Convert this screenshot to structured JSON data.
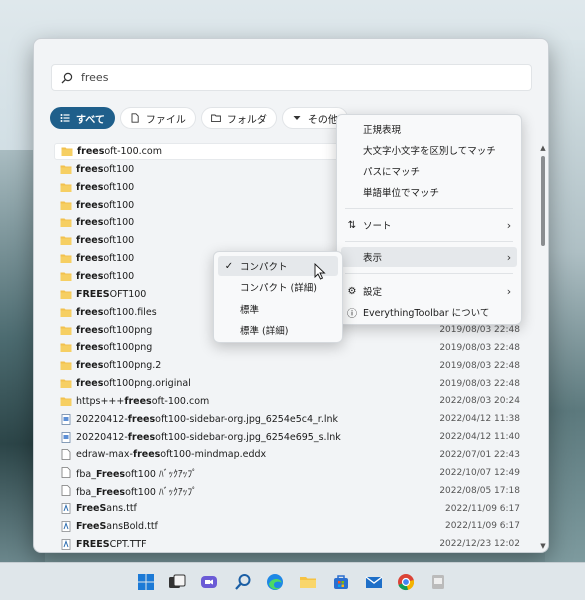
{
  "search": {
    "value": "frees"
  },
  "filters": [
    {
      "label": "すべて",
      "icon": "list-icon",
      "active": true
    },
    {
      "label": "ファイル",
      "icon": "file-icon",
      "active": false
    },
    {
      "label": "フォルダ",
      "icon": "folder-icon",
      "active": false
    },
    {
      "label": "その他",
      "icon": "caret-down-icon",
      "active": false
    }
  ],
  "results": [
    {
      "prefix": "",
      "hl": "frees",
      "rest": "oft-100.com",
      "date": "",
      "type": "folder"
    },
    {
      "prefix": "",
      "hl": "frees",
      "rest": "oft100",
      "date": "",
      "type": "folder"
    },
    {
      "prefix": "",
      "hl": "frees",
      "rest": "oft100",
      "date": "",
      "type": "folder"
    },
    {
      "prefix": "",
      "hl": "frees",
      "rest": "oft100",
      "date": "",
      "type": "folder"
    },
    {
      "prefix": "",
      "hl": "frees",
      "rest": "oft100",
      "date": "",
      "type": "folder"
    },
    {
      "prefix": "",
      "hl": "frees",
      "rest": "oft100",
      "date": "",
      "type": "folder"
    },
    {
      "prefix": "",
      "hl": "frees",
      "rest": "oft100",
      "date": "",
      "type": "folder"
    },
    {
      "prefix": "",
      "hl": "frees",
      "rest": "oft100",
      "date": "",
      "type": "folder"
    },
    {
      "prefix": "",
      "hl": "FREES",
      "rest": "OFT100",
      "date": "",
      "type": "folder"
    },
    {
      "prefix": "",
      "hl": "frees",
      "rest": "oft100.files",
      "date": "",
      "type": "folder"
    },
    {
      "prefix": "",
      "hl": "frees",
      "rest": "oft100png",
      "date": "2019/08/03 22:48",
      "type": "folder"
    },
    {
      "prefix": "",
      "hl": "frees",
      "rest": "oft100png",
      "date": "2019/08/03 22:48",
      "type": "folder"
    },
    {
      "prefix": "",
      "hl": "frees",
      "rest": "oft100png.2",
      "date": "2019/08/03 22:48",
      "type": "folder"
    },
    {
      "prefix": "",
      "hl": "frees",
      "rest": "oft100png.original",
      "date": "2019/08/03 22:48",
      "type": "folder"
    },
    {
      "prefix": "https+++",
      "hl": "frees",
      "rest": "oft-100.com",
      "date": "2022/08/03 20:24",
      "type": "folder"
    },
    {
      "prefix": "20220412-",
      "hl": "frees",
      "rest": "oft100-sidebar-org.jpg_6254e5c4_r.lnk",
      "date": "2022/04/12 11:38",
      "type": "link"
    },
    {
      "prefix": "20220412-",
      "hl": "frees",
      "rest": "oft100-sidebar-org.jpg_6254e695_s.lnk",
      "date": "2022/04/12 11:40",
      "type": "link"
    },
    {
      "prefix": "edraw-max-",
      "hl": "frees",
      "rest": "oft100-mindmap.eddx",
      "date": "2022/07/01 22:43",
      "type": "file"
    },
    {
      "prefix": "fba_",
      "hl": "Frees",
      "rest": "oft100 ﾊﾞｯｸｱｯﾌﾟ",
      "date": "2022/10/07 12:49",
      "type": "doc"
    },
    {
      "prefix": "fba_",
      "hl": "Frees",
      "rest": "oft100 ﾊﾞｯｸｱｯﾌﾟ",
      "date": "2022/08/05 17:18",
      "type": "doc"
    },
    {
      "prefix": "",
      "hl": "FreeS",
      "rest": "ans.ttf",
      "date": "2022/11/09 6:17",
      "type": "font"
    },
    {
      "prefix": "",
      "hl": "FreeS",
      "rest": "ansBold.ttf",
      "date": "2022/11/09 6:17",
      "type": "font"
    },
    {
      "prefix": "",
      "hl": "FREES",
      "rest": "CPT.TTF",
      "date": "2022/12/23 12:02",
      "type": "font"
    }
  ],
  "context_menu": {
    "match_case": "正規表現",
    "case_sensitive": "大文字小文字を区別してマッチ",
    "match_path": "パスにマッチ",
    "whole_word": "単語単位でマッチ",
    "sort": "ソート",
    "view": "表示",
    "settings": "設定",
    "about": "EverythingToolbar について"
  },
  "view_submenu": {
    "compact": "コンパクト",
    "compact_detail": "コンパクト (詳細)",
    "normal": "標準",
    "normal_detail": "標準 (詳細)"
  },
  "colors": {
    "accent": "#1f5f8b",
    "folder": "#f2c14e"
  }
}
